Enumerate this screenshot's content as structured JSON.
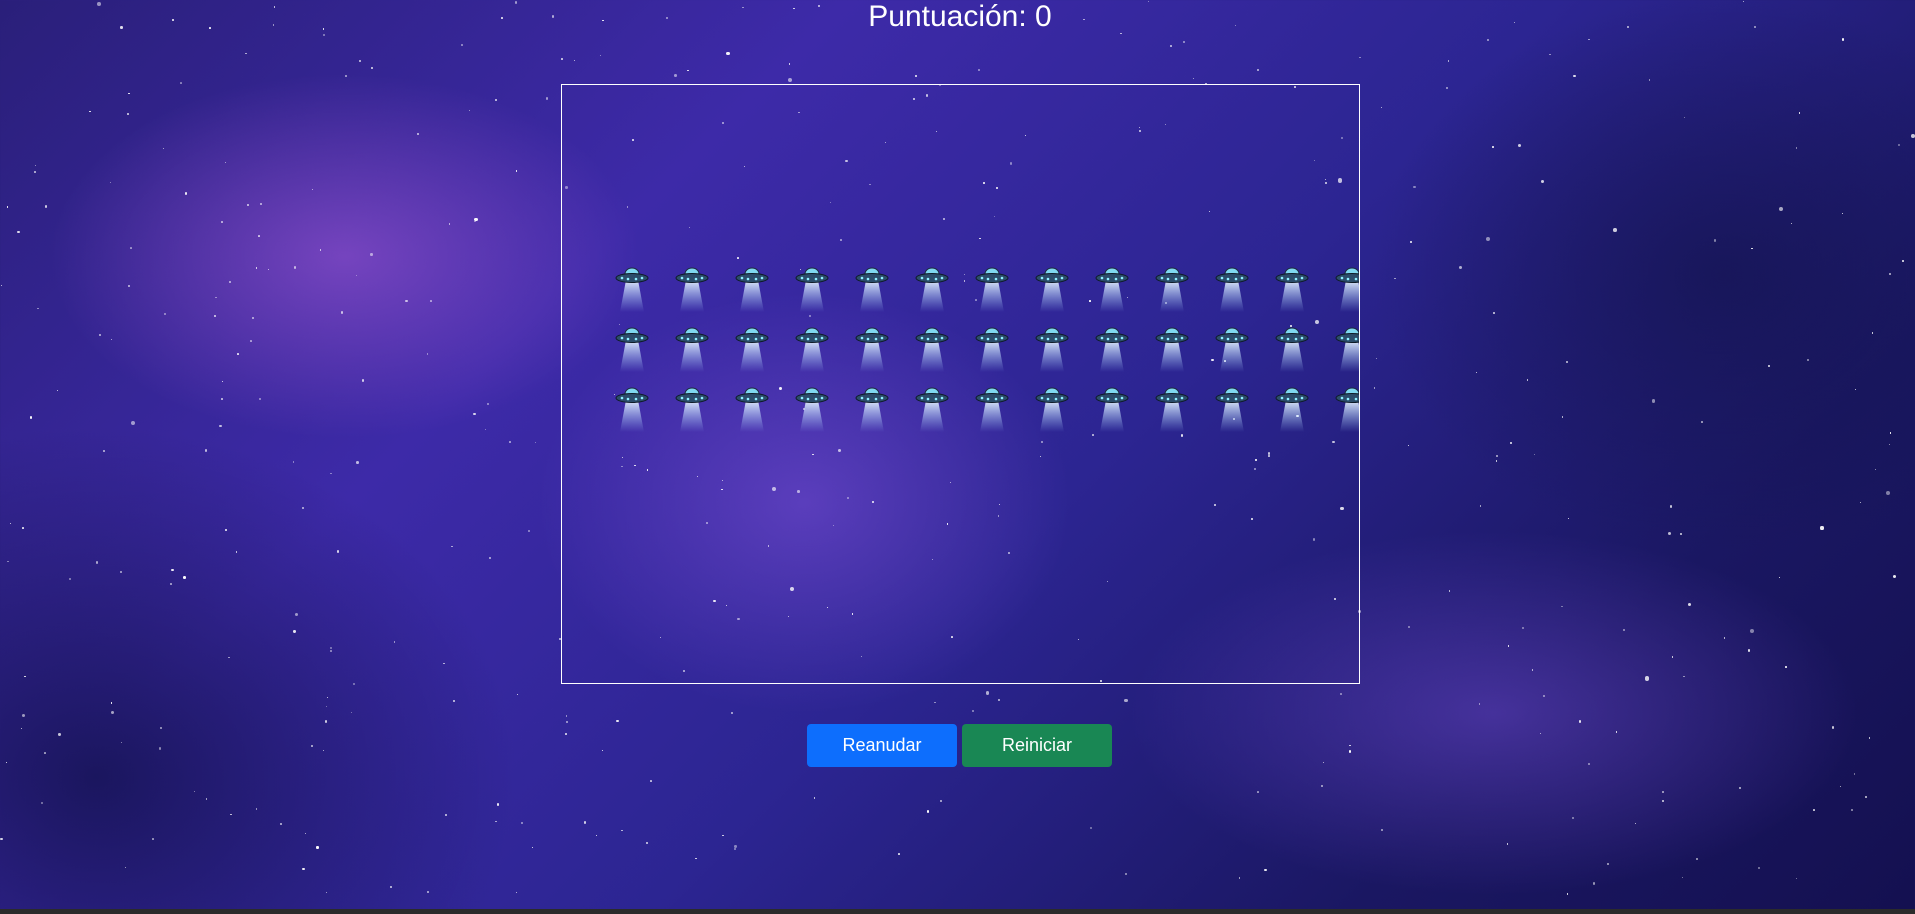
{
  "score": {
    "label": "Puntuación: 0",
    "value": 0
  },
  "game": {
    "enemy_icon": "ufo-icon",
    "rows": 3,
    "columns": 13
  },
  "controls": {
    "resume_label": "Reanudar",
    "restart_label": "Reiniciar"
  },
  "colors": {
    "resume_button": "#0d6efd",
    "restart_button": "#198754",
    "border": "#ffffff",
    "text": "#ffffff"
  }
}
